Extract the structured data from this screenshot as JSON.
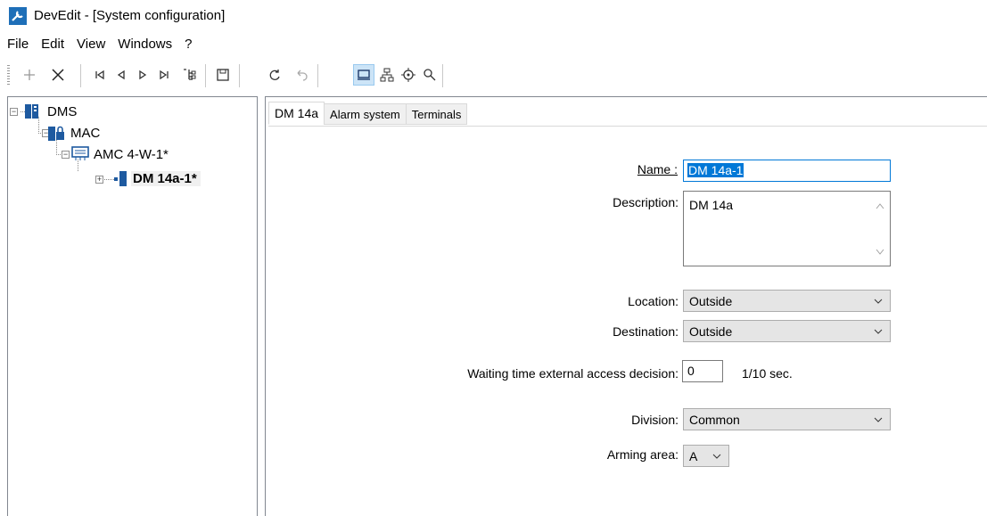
{
  "window": {
    "title": "DevEdit - [System configuration]",
    "icon": "wrench-icon"
  },
  "menu": [
    "File",
    "Edit",
    "View",
    "Windows",
    "?"
  ],
  "toolbar": {
    "buttons": [
      {
        "name": "add-icon"
      },
      {
        "name": "delete-icon"
      },
      {
        "name": "first-icon"
      },
      {
        "name": "previous-icon"
      },
      {
        "name": "next-icon"
      },
      {
        "name": "last-icon"
      },
      {
        "name": "tree-view-icon"
      },
      {
        "name": "save-icon"
      },
      {
        "name": "refresh-icon"
      },
      {
        "name": "undo-icon"
      },
      {
        "name": "computer-view-icon",
        "active": true
      },
      {
        "name": "network-icon"
      },
      {
        "name": "target-icon"
      },
      {
        "name": "search-icon"
      }
    ]
  },
  "tree": {
    "nodes": [
      {
        "label": "DMS",
        "icon": "server-icon"
      },
      {
        "label": "MAC",
        "icon": "server-lock-icon"
      },
      {
        "label": "AMC 4-W-1*",
        "icon": "controller-icon"
      },
      {
        "label": "DM 14a-1*",
        "icon": "door-module-icon",
        "selected": true
      }
    ]
  },
  "tabs": [
    "DM 14a",
    "Alarm system",
    "Terminals"
  ],
  "form": {
    "name_label": "Name :",
    "name_value": "DM 14a-1",
    "description_label": "Description:",
    "description_value": "DM 14a",
    "location_label": "Location:",
    "location_value": "Outside",
    "destination_label": "Destination:",
    "destination_value": "Outside",
    "waiting_label": "Waiting time external access decision:",
    "waiting_value": "0",
    "waiting_unit": "1/10 sec.",
    "division_label": "Division:",
    "division_value": "Common",
    "arming_label": "Arming area:",
    "arming_value": "A"
  },
  "colors": {
    "accent": "#0078d7",
    "selection_bg": "#cce4f7",
    "icon_blue": "#1e5aa0"
  }
}
